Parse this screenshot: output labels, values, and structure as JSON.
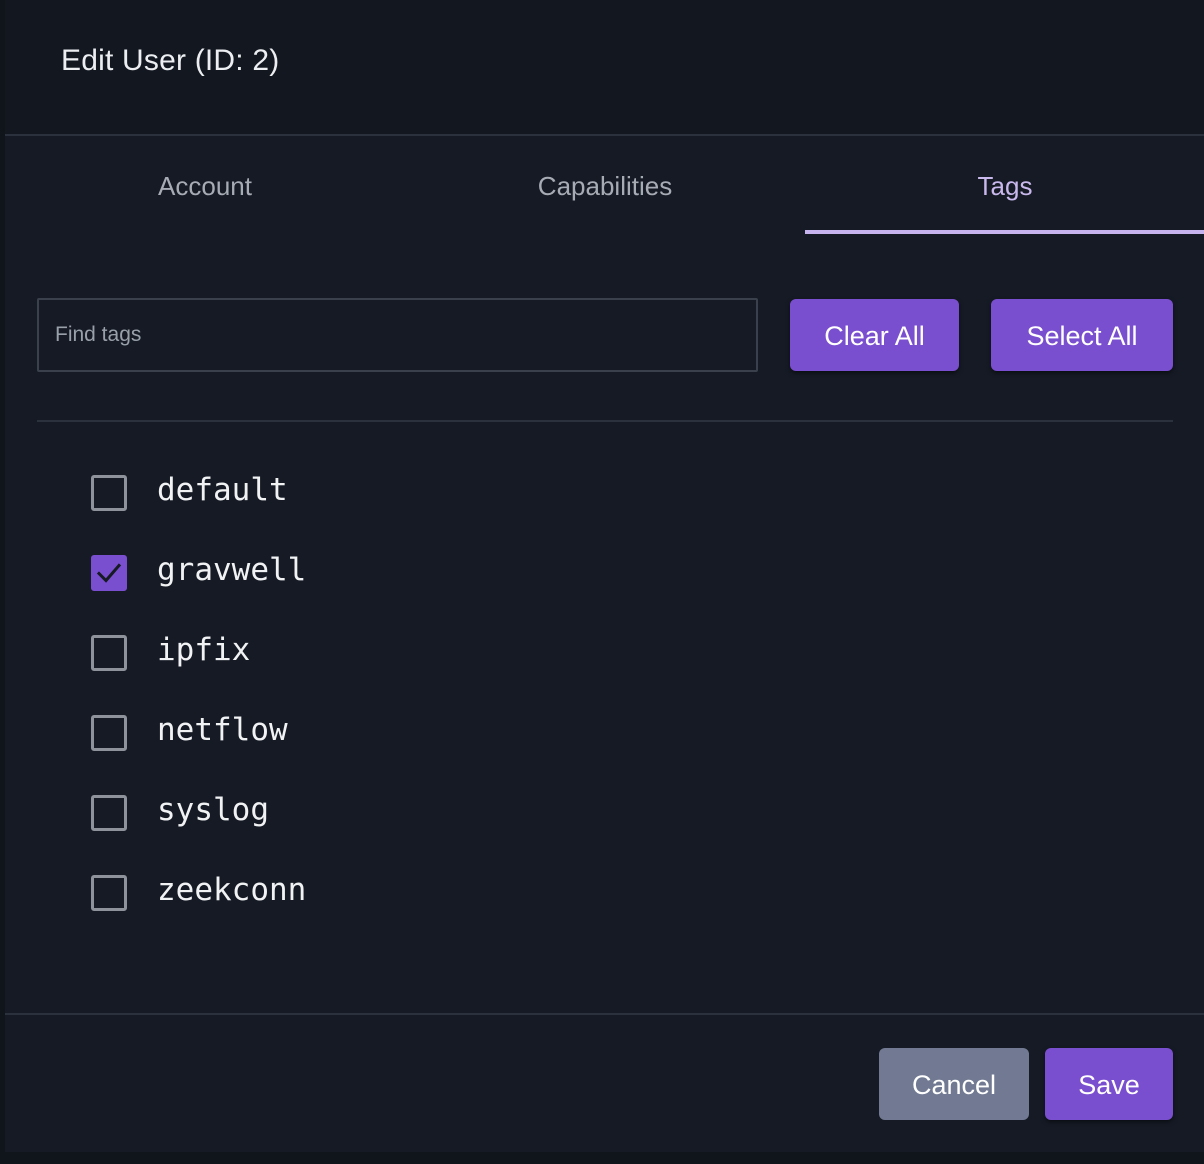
{
  "dialog": {
    "title": "Edit User (ID: 2)"
  },
  "tabs": [
    {
      "label": "Account",
      "active": false
    },
    {
      "label": "Capabilities",
      "active": false
    },
    {
      "label": "Tags",
      "active": true
    }
  ],
  "toolbar": {
    "search_placeholder": "Find tags",
    "search_value": "",
    "clear_all_label": "Clear All",
    "select_all_label": "Select All"
  },
  "tags": [
    {
      "label": "default",
      "checked": false
    },
    {
      "label": "gravwell",
      "checked": true
    },
    {
      "label": "ipfix",
      "checked": false
    },
    {
      "label": "netflow",
      "checked": false
    },
    {
      "label": "syslog",
      "checked": false
    },
    {
      "label": "zeekconn",
      "checked": false
    }
  ],
  "footer": {
    "cancel_label": "Cancel",
    "save_label": "Save"
  },
  "colors": {
    "accent": "#7a4fcf",
    "tab_indicator": "#c7b3ee",
    "cancel_button": "#717a92",
    "background": "#151a24"
  },
  "icons": {
    "checked_mark": "check-icon"
  }
}
